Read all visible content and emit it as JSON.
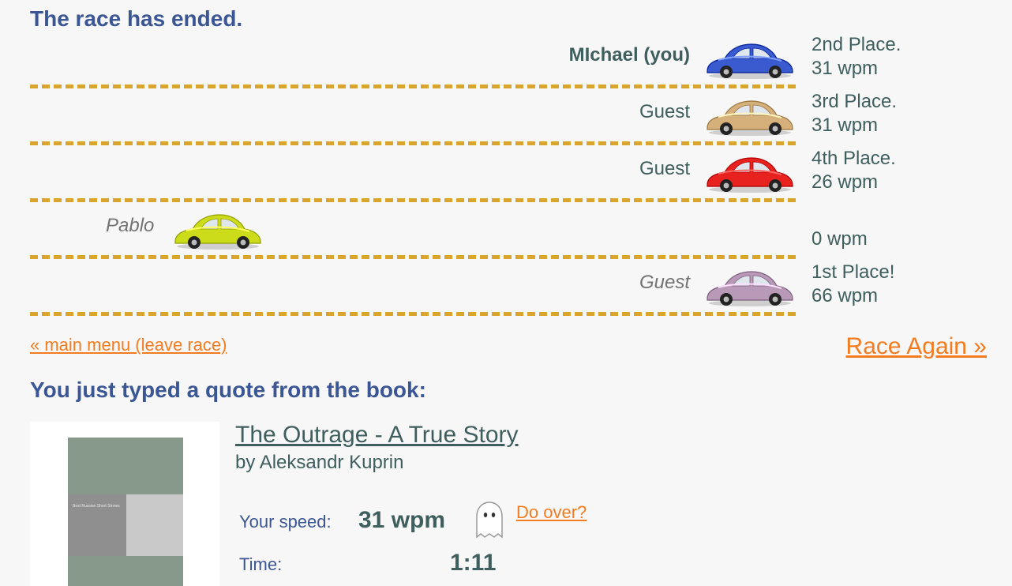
{
  "status": {
    "heading": "The race has ended."
  },
  "racers": [
    {
      "name": "MIchael (you)",
      "style": "bold",
      "car_color": "#3a5bd0",
      "place": "2nd Place.",
      "wpm": "31 wpm",
      "progress": 1.0
    },
    {
      "name": "Guest",
      "style": "normal",
      "car_color": "#d6b07a",
      "place": "3rd Place.",
      "wpm": "31 wpm",
      "progress": 1.0
    },
    {
      "name": "Guest",
      "style": "normal",
      "car_color": "#e8221f",
      "place": "4th Place.",
      "wpm": "26 wpm",
      "progress": 1.0
    },
    {
      "name": "Pablo",
      "style": "italic",
      "car_color": "#cddc1a",
      "place": "",
      "wpm": "0 wpm",
      "progress": 0.1
    },
    {
      "name": "Guest",
      "style": "italic",
      "car_color": "#b89ab8",
      "place": "1st Place!",
      "wpm": "66 wpm",
      "progress": 1.0
    }
  ],
  "nav": {
    "main_menu": "« main menu (leave race)",
    "race_again": "Race Again »"
  },
  "quote": {
    "heading": "You just typed a quote from the book:",
    "book_title": "The Outrage - A True Story",
    "author": "by Aleksandr Kuprin",
    "cover_text": "Best Russian Short Stories"
  },
  "stats": {
    "speed_label": "Your speed:",
    "speed_value": "31 wpm",
    "do_over": "Do over?",
    "time_label": "Time:",
    "time_value": "1:11"
  },
  "icons": {
    "car": "car-icon",
    "ghost": "ghost-icon"
  },
  "colors": {
    "heading": "#3b5694",
    "link": "#f47c20",
    "lane_line": "#d9a62b",
    "text": "#3f5e5e"
  }
}
